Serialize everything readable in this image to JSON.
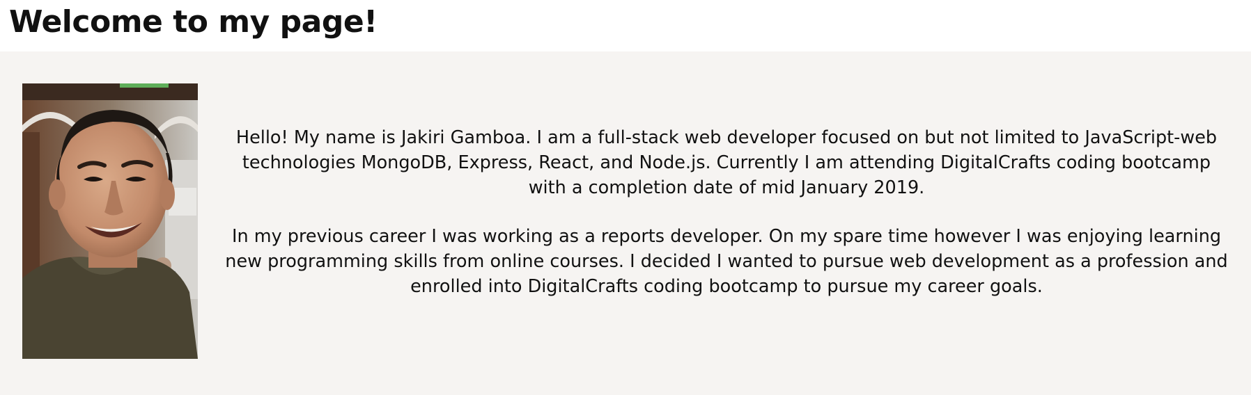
{
  "header": {
    "title": "Welcome to my page!"
  },
  "about": {
    "photo_icon": "portrait-photo",
    "paragraphs": [
      "Hello! My name is Jakiri Gamboa. I am a full-stack web developer focused on but not limited to JavaScript-web technologies MongoDB, Express, React, and Node.js. Currently I am attending DigitalCrafts coding bootcamp with a completion date of mid January 2019.",
      "In my previous career I was working as a reports developer. On my spare time however I was enjoying learning new programming skills from online courses. I decided I wanted to pursue web development as a profession and enrolled into DigitalCrafts coding bootcamp to pursue my career goals."
    ]
  },
  "colors": {
    "header_bg": "#ffffff",
    "section_bg": "#f6f4f2",
    "text": "#111111"
  }
}
